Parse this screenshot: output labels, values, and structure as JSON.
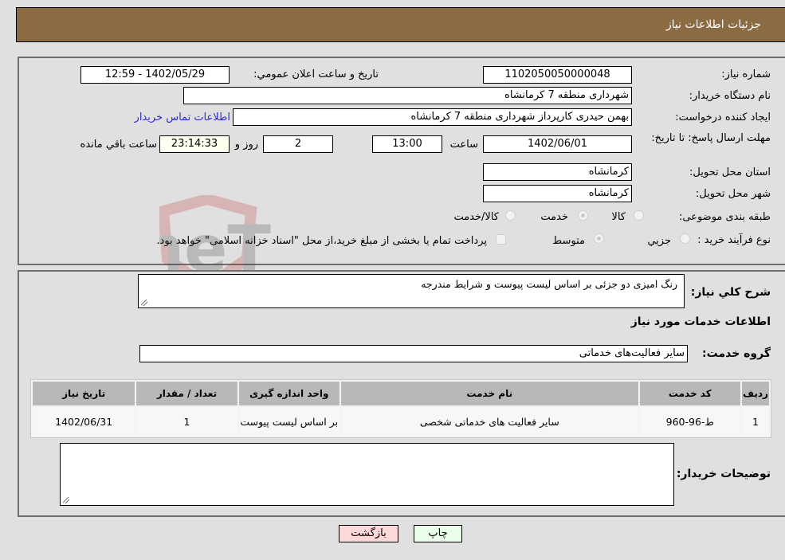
{
  "header": {
    "title": "جزئیات اطلاعات نیاز"
  },
  "fields": {
    "need_number_label": "شماره نیاز:",
    "need_number": "1102050050000048",
    "announce_label": "تاریخ و ساعت اعلان عمومي:",
    "announce_value": "1402/05/29 - 12:59",
    "buyer_org_label": "نام دستگاه خریدار:",
    "buyer_org": "شهرداری منطقه 7 کرمانشاه",
    "creator_label": "ایجاد کننده درخواست:",
    "creator": "بهمن حیدری کارپرداز شهرداری منطقه 7 کرمانشاه",
    "contact_link": "اطلاعات تماس خریدار",
    "deadline_label": "مهلت ارسال پاسخ: تا تاریخ:",
    "deadline_date": "1402/06/01",
    "time_label": "ساعت",
    "deadline_time": "13:00",
    "days": "2",
    "days_label": "روز و",
    "remaining": "23:14:33",
    "remaining_label": "ساعت باقي مانده",
    "province_label": "استان محل تحویل:",
    "province": "کرمانشاه",
    "city_label": "شهر محل تحویل:",
    "city": "کرمانشاه",
    "category_label": "طبقه بندی موضوعی:",
    "category_options": [
      "کالا",
      "خدمت",
      "کالا/خدمت"
    ],
    "category_selected": "خدمت",
    "process_label": "نوع فرآیند خرید :",
    "process_options": [
      "جزيي",
      "متوسط"
    ],
    "process_selected": "متوسط",
    "treasury_note": "پرداخت تمام یا بخشی از مبلغ خرید،از محل \"اسناد خزانه اسلامی\" خواهد بود."
  },
  "details": {
    "description_label": "شرح کلي نیاز:",
    "description": "رنگ امیزی دو جزئی  بر اساس لیست پیوست و شرایط مندرجه",
    "services_heading": "اطلاعات خدمات مورد نیاز",
    "service_group_label": "گروه خدمت:",
    "service_group": "سایر فعالیت‌های خدماتی",
    "table": {
      "headers": [
        "ردیف",
        "کد خدمت",
        "نام خدمت",
        "واحد اندازه گیری",
        "تعداد / مقدار",
        "تاریخ نیاز"
      ],
      "rows": [
        [
          "1",
          "ط-96-960",
          "سایر فعالیت های خدماتی شخصی",
          "بر اساس لیست پیوست",
          "1",
          "1402/06/31"
        ]
      ]
    },
    "buyer_notes_label": "توضیحات خریدار:",
    "buyer_notes": ""
  },
  "buttons": {
    "print": "چاپ",
    "back": "بازگشت"
  },
  "watermark": {
    "text": "AriaTender.neT"
  }
}
